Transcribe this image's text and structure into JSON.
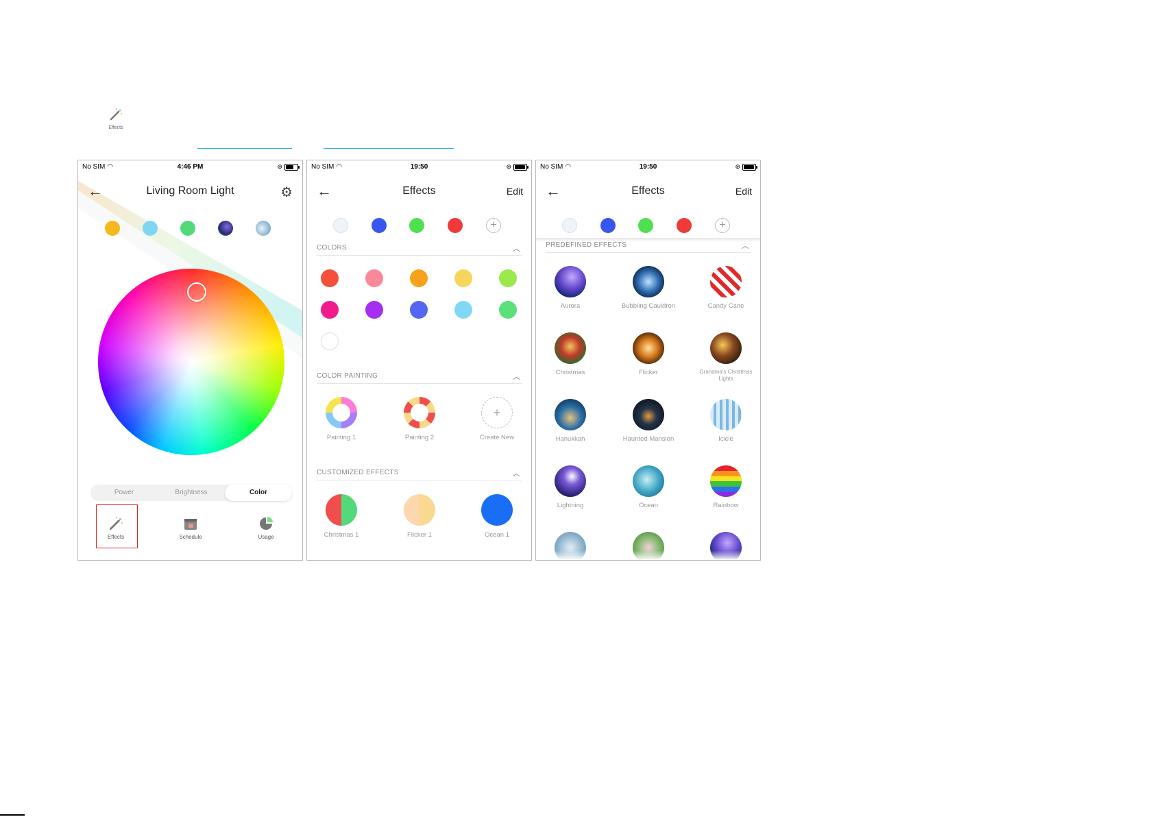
{
  "top_icon": {
    "label": "Effects"
  },
  "phone1": {
    "status": {
      "carrier": "No SIM",
      "time": "4:46 PM"
    },
    "title": "Living Room Light",
    "tabs": [
      "Power",
      "Brightness",
      "Color"
    ],
    "active_tab": "Color",
    "bottom": [
      {
        "label": "Effects",
        "icon": "magic-wand-icon"
      },
      {
        "label": "Schedule",
        "icon": "calendar-icon"
      },
      {
        "label": "Usage",
        "icon": "pie-chart-icon"
      }
    ],
    "presets": [
      "#f6b81d",
      "#7fd6f3",
      "#52d97a",
      "aurora",
      "moon"
    ]
  },
  "phone2": {
    "status": {
      "carrier": "No SIM",
      "time": "19:50"
    },
    "title": "Effects",
    "edit": "Edit",
    "favorites": [
      "#eef4fa",
      "#3756f0",
      "#4fe04f",
      "#f03a3a"
    ],
    "sections": {
      "colors": "COLORS",
      "painting": "COLOR PAINTING",
      "customized": "CUSTOMIZED EFFECTS"
    },
    "colors": [
      "#f4503a",
      "#f98899",
      "#f7a21b",
      "#f7d55c",
      "#9ae94d",
      "#f01c8c",
      "#a52ef0",
      "#5566f2",
      "#82d8f4",
      "#5ce07a",
      "#ffffff"
    ],
    "paintings": [
      {
        "label": "Painting 1"
      },
      {
        "label": "Painting 2"
      },
      {
        "label": "Create New"
      }
    ],
    "customized": [
      {
        "label": "Christmas 1"
      },
      {
        "label": "Flicker 1"
      },
      {
        "label": "Ocean 1"
      }
    ]
  },
  "phone3": {
    "status": {
      "carrier": "No SIM",
      "time": "19:50"
    },
    "title": "Effects",
    "edit": "Edit",
    "section": "PREDEFINED EFFECTS",
    "effects": [
      {
        "label": "Aurora"
      },
      {
        "label": "Bubbling Cauldron"
      },
      {
        "label": "Candy Cane"
      },
      {
        "label": "Christmas"
      },
      {
        "label": "Flicker"
      },
      {
        "label": "Grandma's Christmas Lights"
      },
      {
        "label": "Hanukkah"
      },
      {
        "label": "Haunted Mansion"
      },
      {
        "label": "Icicle"
      },
      {
        "label": "Lightning"
      },
      {
        "label": "Ocean"
      },
      {
        "label": "Rainbow"
      },
      {
        "label": ""
      },
      {
        "label": ""
      },
      {
        "label": ""
      }
    ]
  }
}
